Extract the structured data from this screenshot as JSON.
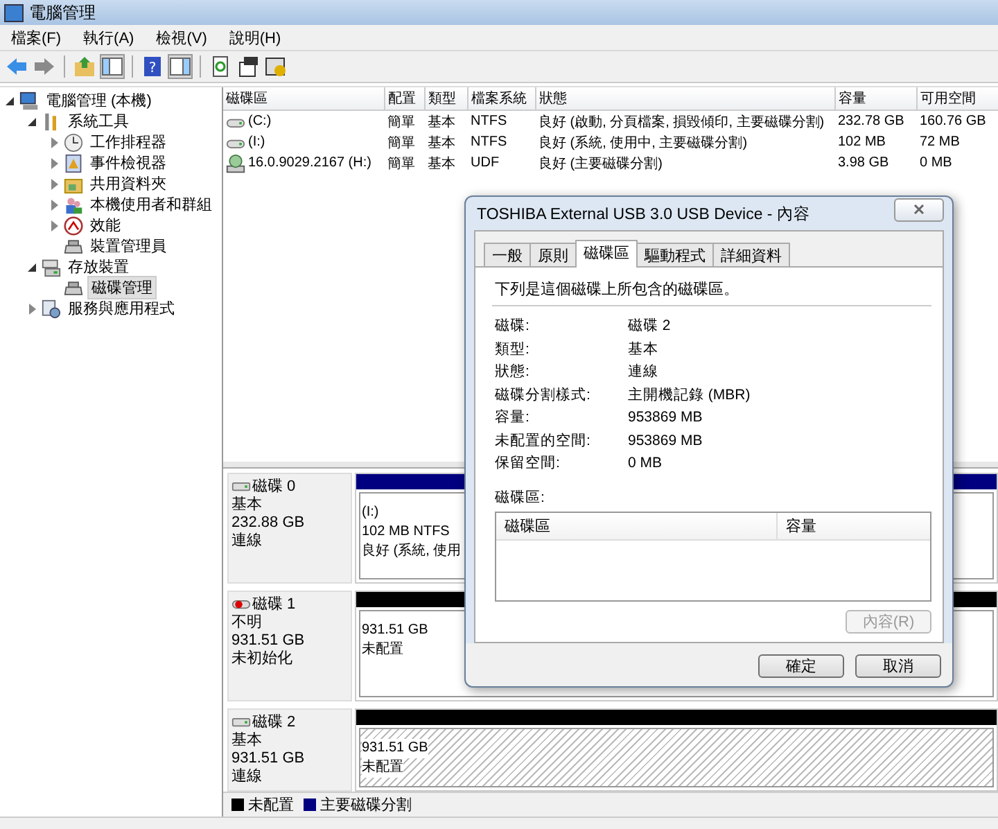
{
  "window": {
    "title": "電腦管理"
  },
  "menu": [
    {
      "label": "檔案(F)"
    },
    {
      "label": "執行(A)"
    },
    {
      "label": "檢視(V)"
    },
    {
      "label": "說明(H)"
    }
  ],
  "toolbar": {
    "help_glyph": "?"
  },
  "tree": [
    {
      "label": "電腦管理 (本機)",
      "kind": "computer",
      "selected": false,
      "expanded": true,
      "children": [
        {
          "label": "系統工具",
          "kind": "tools",
          "selected": false,
          "expanded": true,
          "children": [
            {
              "label": "工作排程器",
              "kind": "clock",
              "selected": false,
              "expanded": false
            },
            {
              "label": "事件檢視器",
              "kind": "log",
              "selected": false,
              "expanded": false
            },
            {
              "label": "共用資料夾",
              "kind": "folder",
              "selected": false,
              "expanded": false
            },
            {
              "label": "本機使用者和群組",
              "kind": "users",
              "selected": false,
              "expanded": false
            },
            {
              "label": "效能",
              "kind": "gauge",
              "selected": false,
              "expanded": false
            },
            {
              "label": "裝置管理員",
              "kind": "device",
              "selected": false
            }
          ]
        },
        {
          "label": "存放裝置",
          "kind": "storage",
          "selected": false,
          "expanded": true,
          "children": [
            {
              "label": "磁碟管理",
              "kind": "device",
              "selected": true
            }
          ]
        },
        {
          "label": "服務與應用程式",
          "kind": "services",
          "selected": false,
          "expanded": false
        }
      ]
    }
  ],
  "volumes": {
    "columns": [
      "磁碟區",
      "配置",
      "類型",
      "檔案系統",
      "狀態",
      "容量",
      "可用空間"
    ],
    "rows": [
      {
        "kind": "disk",
        "cells": [
          "(C:)",
          "簡單",
          "基本",
          "NTFS",
          "良好 (啟動, 分頁檔案, 損毀傾印, 主要磁碟分割)",
          "232.78 GB",
          "160.76 GB"
        ]
      },
      {
        "kind": "disk",
        "cells": [
          "(I:)",
          "簡單",
          "基本",
          "NTFS",
          "良好 (系統, 使用中, 主要磁碟分割)",
          "102 MB",
          "72 MB"
        ]
      },
      {
        "kind": "cd",
        "cells": [
          "16.0.9029.2167 (H:)",
          "簡單",
          "基本",
          "UDF",
          "良好 (主要磁碟分割)",
          "3.98 GB",
          "0 MB"
        ]
      }
    ]
  },
  "disks": [
    {
      "name": "磁碟 0",
      "kind": "online",
      "lines": [
        "基本",
        "232.88 GB",
        "連線"
      ],
      "partitions": [
        {
          "kind": "primary",
          "selected": false,
          "lines": [
            "(I:)",
            "102 MB NTFS",
            "良好 (系統, 使用"
          ]
        }
      ]
    },
    {
      "name": "磁碟 1",
      "kind": "error",
      "lines": [
        "不明",
        "931.51 GB",
        "未初始化"
      ],
      "partitions": [
        {
          "kind": "unallocated",
          "selected": false,
          "lines": [
            "931.51 GB",
            "未配置"
          ]
        }
      ]
    },
    {
      "name": "磁碟 2",
      "kind": "online",
      "lines": [
        "基本",
        "931.51 GB",
        "連線"
      ],
      "partitions": [
        {
          "kind": "unallocated",
          "selected": true,
          "lines": [
            "931.51 GB",
            "未配置"
          ]
        }
      ]
    }
  ],
  "legend": [
    {
      "label": "未配置",
      "color": "#000000"
    },
    {
      "label": "主要磁碟分割",
      "color": "#000080"
    }
  ],
  "dialog": {
    "title": "TOSHIBA External USB 3.0 USB Device - 內容",
    "tabs": [
      {
        "label": "一般",
        "selected": false
      },
      {
        "label": "原則",
        "selected": false
      },
      {
        "label": "磁碟區",
        "selected": true
      },
      {
        "label": "驅動程式",
        "selected": false
      },
      {
        "label": "詳細資料",
        "selected": false
      }
    ],
    "description": "下列是這個磁碟上所包含的磁碟區。",
    "properties": [
      {
        "label": "磁碟:",
        "value": "磁碟 2"
      },
      {
        "label": "類型:",
        "value": "基本"
      },
      {
        "label": "狀態:",
        "value": "連線"
      },
      {
        "label": "磁碟分割樣式:",
        "value": "主開機記錄 (MBR)"
      },
      {
        "label": "容量:",
        "value": "953869 MB"
      },
      {
        "label": "未配置的空間:",
        "value": "953869 MB"
      },
      {
        "label": "保留空間:",
        "value": "0 MB"
      }
    ],
    "list_label": "磁碟區:",
    "list_columns": [
      "磁碟區",
      "容量"
    ],
    "properties_button": {
      "label": "內容(R)",
      "disabled": true
    },
    "buttons": [
      "確定",
      "取消"
    ]
  }
}
